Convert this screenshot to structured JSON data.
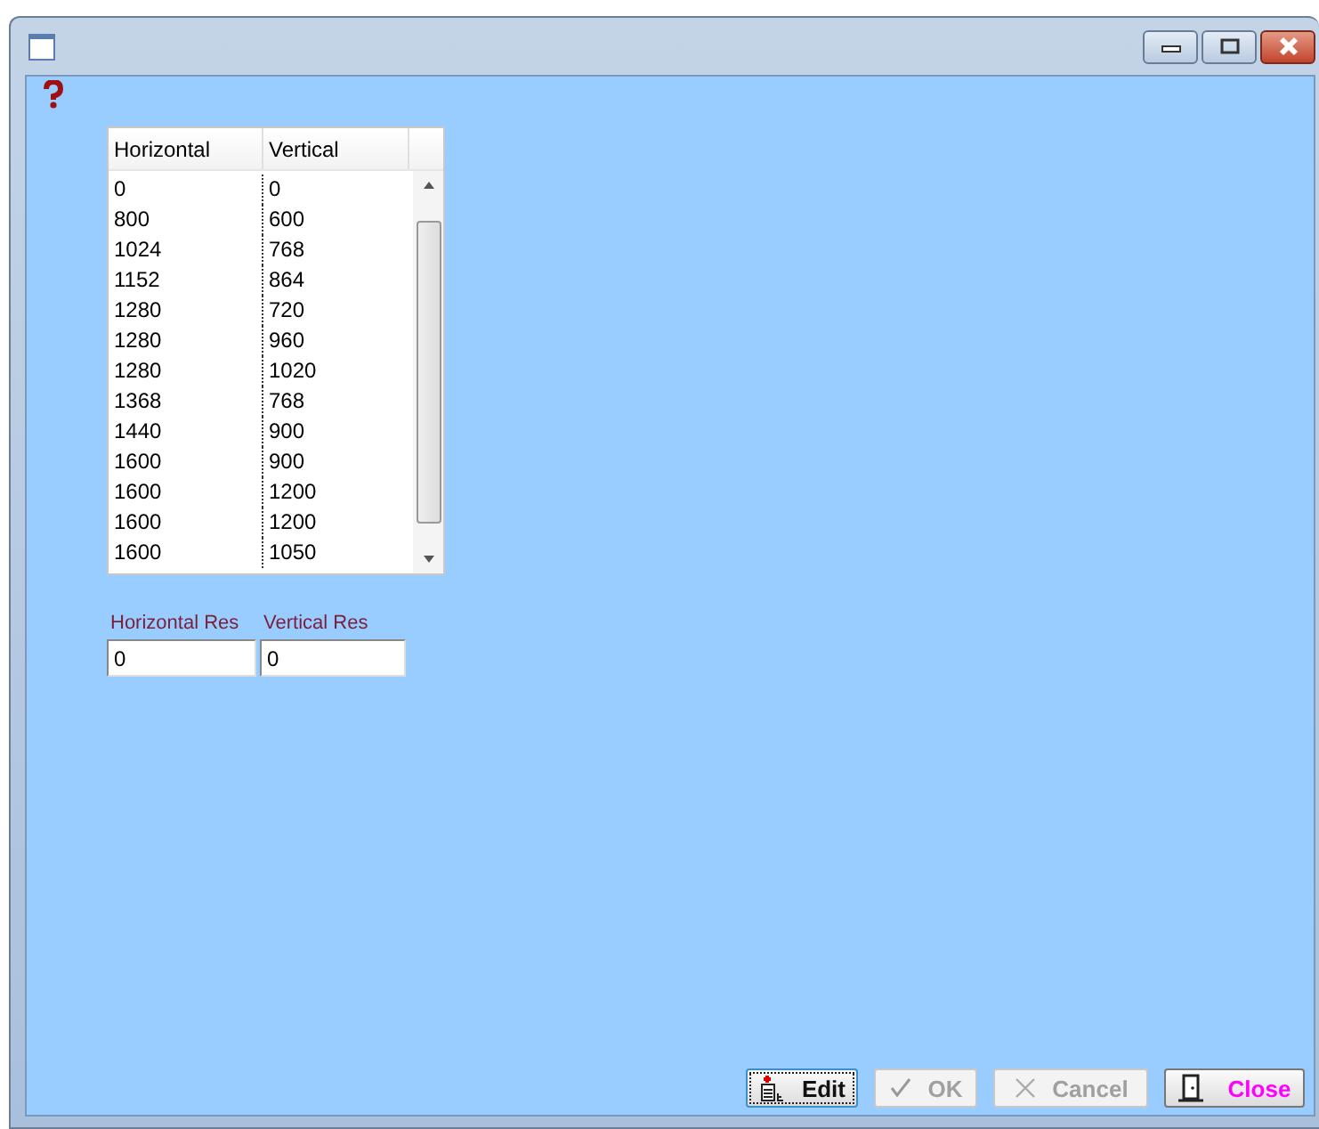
{
  "table": {
    "columns": [
      "Horizontal",
      "Vertical"
    ],
    "rows": [
      [
        "0",
        "0"
      ],
      [
        "800",
        "600"
      ],
      [
        "1024",
        "768"
      ],
      [
        "1152",
        "864"
      ],
      [
        "1280",
        "720"
      ],
      [
        "1280",
        "960"
      ],
      [
        "1280",
        "1020"
      ],
      [
        "1368",
        "768"
      ],
      [
        "1440",
        "900"
      ],
      [
        "1600",
        "900"
      ],
      [
        "1600",
        "1200"
      ],
      [
        "1600",
        "1200"
      ],
      [
        "1600",
        "1050"
      ]
    ]
  },
  "fields": [
    {
      "label": "Horizontal Res",
      "value": "0"
    },
    {
      "label": "Vertical Res",
      "value": "0"
    }
  ],
  "buttons": [
    {
      "kind": "edit",
      "label": "Edit",
      "disabled": false
    },
    {
      "kind": "ok",
      "label": "OK",
      "disabled": true
    },
    {
      "kind": "cancel",
      "label": "Cancel",
      "disabled": true
    },
    {
      "kind": "close",
      "label": "Close",
      "disabled": false
    }
  ]
}
